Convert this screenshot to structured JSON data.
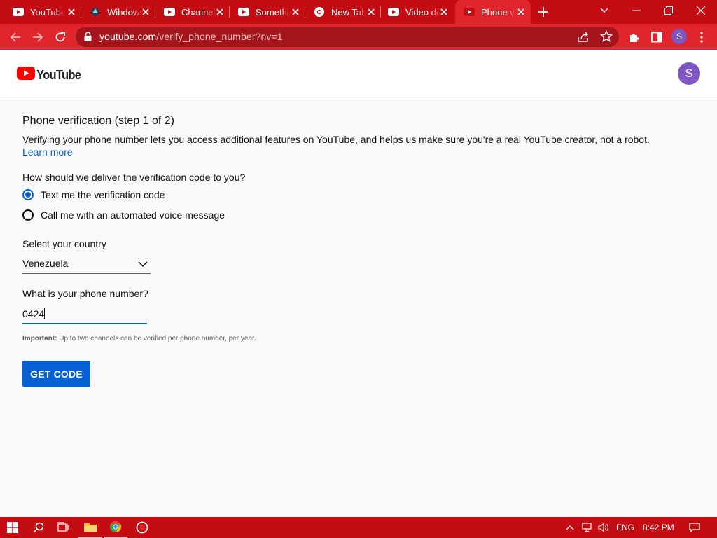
{
  "browser": {
    "tabs": [
      {
        "title": "YouTube",
        "favicon": "youtube-icon",
        "active": false
      },
      {
        "title": "Wibdows",
        "favicon": "app-icon",
        "active": false
      },
      {
        "title": "Channel",
        "favicon": "youtube-icon",
        "active": false
      },
      {
        "title": "Something",
        "favicon": "youtube-icon",
        "active": false
      },
      {
        "title": "New Tab",
        "favicon": "chrome-icon",
        "active": false
      },
      {
        "title": "Video de",
        "favicon": "youtube-icon",
        "active": false
      },
      {
        "title": "Phone v",
        "favicon": "youtube-icon",
        "active": true
      }
    ],
    "url_host": "youtube.com",
    "url_path": "/verify_phone_number?nv=1",
    "profile_initial": "S",
    "accent_color": "#e0262c"
  },
  "header": {
    "logo_text": "YouTube",
    "avatar_initial": "S"
  },
  "verification": {
    "title": "Phone verification (step 1 of 2)",
    "description": "Verifying your phone number lets you access additional features on YouTube, and helps us make sure you're a real YouTube creator, not a robot.",
    "learn_more": "Learn more",
    "delivery_question": "How should we deliver the verification code to you?",
    "options": [
      {
        "label": "Text me the verification code",
        "selected": true
      },
      {
        "label": "Call me with an automated voice message",
        "selected": false
      }
    ],
    "country_label": "Select your country",
    "country_value": "Venezuela",
    "phone_label": "What is your phone number?",
    "phone_value": "0424",
    "note_bold": "Important:",
    "note_text": " Up to two channels can be verified per phone number, per year.",
    "button": "GET CODE",
    "primary_color": "#065fd4"
  },
  "taskbar": {
    "language": "ENG",
    "time": "8:42 PM"
  }
}
